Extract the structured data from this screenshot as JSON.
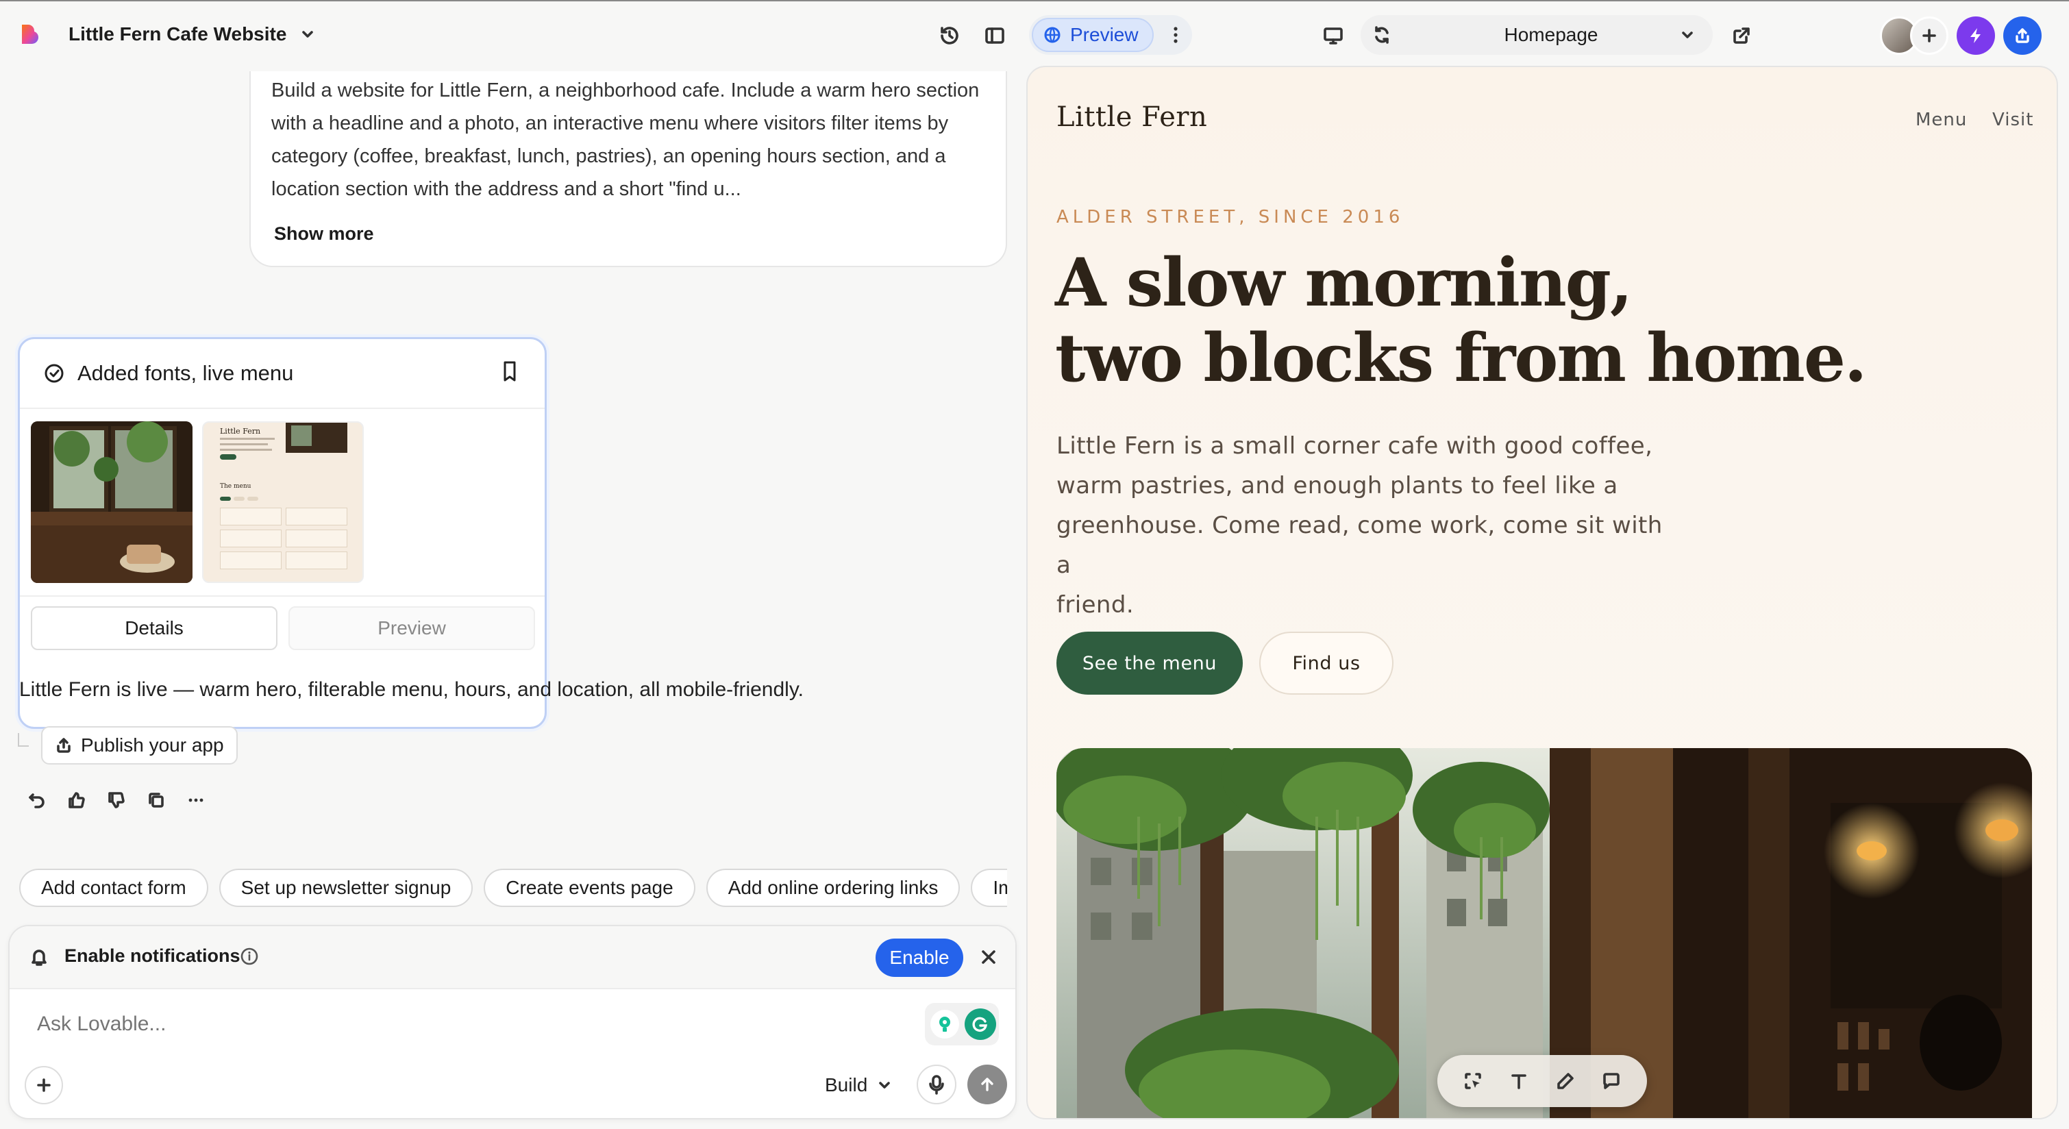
{
  "header": {
    "project_title": "Little Fern Cafe Website",
    "preview_label": "Preview",
    "page_select": "Homepage"
  },
  "chat": {
    "user_message": "Build a website for Little Fern, a neighborhood cafe. Include a warm hero section with a headline and a photo, an interactive menu where visitors filter items by category (coffee, breakfast, lunch, pastries), an opening hours section, and a location section with the address and a short \"find u...",
    "show_more": "Show more",
    "version_card": {
      "title": "Added fonts, live menu",
      "details_label": "Details",
      "preview_label": "Preview",
      "thumb_title": "Little Fern",
      "thumb_menu_title": "The menu"
    },
    "assistant_message": "Little Fern is live — warm hero, filterable menu, hours, and location, all mobile-friendly.",
    "publish_label": "Publish your app",
    "suggestions": [
      "Add contact form",
      "Set up newsletter signup",
      "Create events page",
      "Add online ordering links",
      "Improve m"
    ],
    "notification": {
      "label": "Enable notifications",
      "enable_label": "Enable"
    },
    "composer": {
      "placeholder": "Ask Lovable...",
      "mode": "Build"
    }
  },
  "site": {
    "brand": "Little Fern",
    "nav": [
      "Menu",
      "Visit"
    ],
    "eyebrow": "ALDER STREET, SINCE 2016",
    "headline_line1": "A slow morning,",
    "headline_line2": "two blocks from home.",
    "intro_line1": "Little Fern is a small corner cafe with good coffee,",
    "intro_line2": "warm pastries, and enough plants to feel like a",
    "intro_line3": "greenhouse. Come read, come work, come sit with a",
    "intro_line4": "friend.",
    "cta_primary": "See the menu",
    "cta_secondary": "Find us"
  },
  "colors": {
    "accent_blue": "#2563eb",
    "brand_green": "#2f5d3f",
    "eyebrow_orange": "#c98a55",
    "headline_dark": "#2d2318",
    "preview_bg": "#fbf3ea"
  },
  "icons": [
    "lovable-logo-icon",
    "history-icon",
    "panel-icon",
    "globe-icon",
    "more-vertical-icon",
    "monitor-icon",
    "refresh-icon",
    "external-link-icon",
    "plus-icon",
    "bolt-icon",
    "share-icon",
    "check-circle-icon",
    "bookmark-icon",
    "upload-icon",
    "undo-icon",
    "thumbs-up-icon",
    "thumbs-down-icon",
    "copy-icon",
    "bell-icon",
    "info-icon",
    "close-icon",
    "microphone-icon",
    "arrow-up-icon",
    "select-icon",
    "text-icon",
    "pencil-icon",
    "comment-icon"
  ]
}
